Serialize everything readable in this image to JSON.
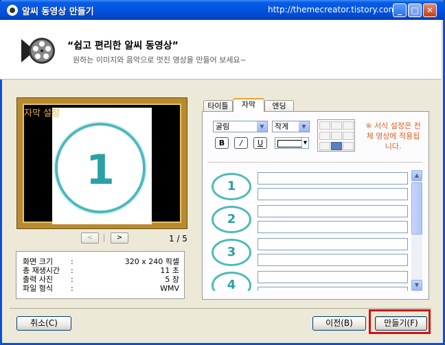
{
  "window": {
    "title": "알씨 동영상 만들기",
    "url": "http://themecreator.tistory.com"
  },
  "header": {
    "title": "“쉽고 편리한 알씨 동영상”",
    "subtitle": "원하는 이미지와 음악으로 멋진 영상을 만들어 보세요~"
  },
  "preview": {
    "caption": "자막 설정",
    "slide_number": "1",
    "page_indicator": "1 / 5",
    "prev_glyph": "<",
    "next_glyph": ">"
  },
  "info": {
    "rows": [
      {
        "label": "화면 크기",
        "colon": ":",
        "value": "320 x 240 픽셀"
      },
      {
        "label": "총 재생시간",
        "colon": ":",
        "value": "11 초"
      },
      {
        "label": "출력 사진",
        "colon": ":",
        "value": "5 장"
      },
      {
        "label": "파일 형식",
        "colon": ":",
        "value": "WMV"
      }
    ]
  },
  "tabs": [
    "타이틀",
    "자막",
    "엔딩"
  ],
  "subtitle_panel": {
    "font_select": "굴림",
    "size_select": "작게",
    "bold": "B",
    "italic": "/",
    "underline": "U",
    "format_note": "※ 서식 설정은 전체 영상에 적용됩니다.",
    "rows": [
      "1",
      "2",
      "3",
      "4"
    ]
  },
  "buttons": {
    "cancel": "취소(C)",
    "prev": "이전(B)",
    "make": "만들기(F)"
  },
  "colors": {
    "accent_teal": "#2aa1a6",
    "note_orange": "#e0601e",
    "highlight_red": "#d41010"
  }
}
